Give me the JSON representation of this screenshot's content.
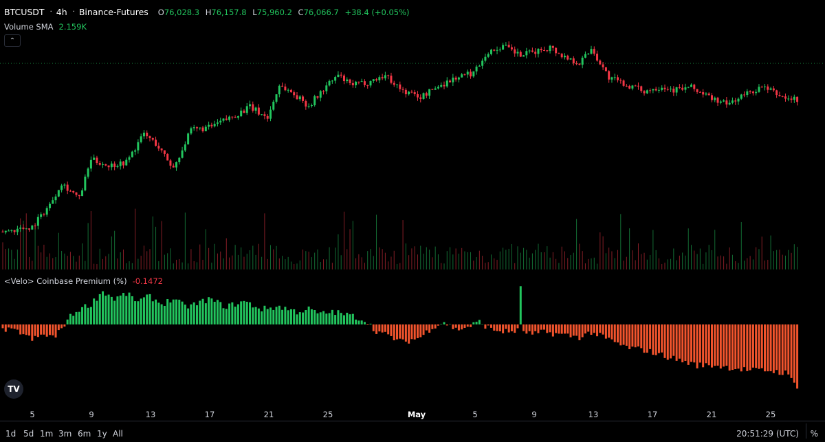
{
  "header": {
    "symbol": "BTCUSDT",
    "timeframe": "4h",
    "exchange": "Binance-Futures",
    "open_key": "O",
    "open": "76,028.3",
    "high_key": "H",
    "high": "76,157.8",
    "low_key": "L",
    "low": "75,960.2",
    "close_key": "C",
    "close": "76,066.7",
    "change": "+38.4 (+0.05%)"
  },
  "volume": {
    "label": "Volume SMA",
    "value": "2.159K"
  },
  "premium": {
    "label": "<Velo> Coinbase Premium (%)",
    "value": "-0.1472"
  },
  "collapse_icon": "chevron-up-icon",
  "logo": "TV",
  "colors": {
    "up": "#22c55e",
    "down": "#f23645",
    "premium_down": "#f2542d",
    "background": "#000000"
  },
  "x_axis": {
    "labels": [
      "5",
      "9",
      "13",
      "17",
      "21",
      "25",
      "May",
      "5",
      "9",
      "13",
      "17",
      "21",
      "25"
    ],
    "emphasized": "May"
  },
  "timeframes": [
    "1d",
    "5d",
    "1m",
    "3m",
    "6m",
    "1y",
    "All"
  ],
  "clock": "20:51:29 (UTC)",
  "percent_toggle": "%",
  "chart_data": {
    "type": "candlestick",
    "interval": "4h",
    "x_ticks": [
      "5",
      "9",
      "13",
      "17",
      "21",
      "25",
      "May",
      "5",
      "9",
      "13",
      "17",
      "21",
      "25"
    ],
    "price_waypoints": [
      [
        0,
        62300
      ],
      [
        10,
        62700
      ],
      [
        16,
        64500
      ],
      [
        20,
        66300
      ],
      [
        26,
        65000
      ],
      [
        30,
        68200
      ],
      [
        36,
        67700
      ],
      [
        42,
        68000
      ],
      [
        48,
        70300
      ],
      [
        52,
        69500
      ],
      [
        58,
        67500
      ],
      [
        64,
        70600
      ],
      [
        70,
        70800
      ],
      [
        78,
        71700
      ],
      [
        84,
        72500
      ],
      [
        90,
        71600
      ],
      [
        94,
        74300
      ],
      [
        98,
        73700
      ],
      [
        104,
        72600
      ],
      [
        110,
        74200
      ],
      [
        114,
        75100
      ],
      [
        118,
        74300
      ],
      [
        124,
        74500
      ],
      [
        130,
        75100
      ],
      [
        136,
        73800
      ],
      [
        142,
        73300
      ],
      [
        148,
        74200
      ],
      [
        154,
        74900
      ],
      [
        160,
        75300
      ],
      [
        164,
        76800
      ],
      [
        170,
        77500
      ],
      [
        176,
        76700
      ],
      [
        182,
        77100
      ],
      [
        186,
        77400
      ],
      [
        190,
        76700
      ],
      [
        196,
        76100
      ],
      [
        200,
        77300
      ],
      [
        206,
        74900
      ],
      [
        212,
        74300
      ],
      [
        218,
        73800
      ],
      [
        224,
        74200
      ],
      [
        228,
        73900
      ],
      [
        234,
        74100
      ],
      [
        240,
        73300
      ],
      [
        246,
        72700
      ],
      [
        252,
        73500
      ],
      [
        258,
        74100
      ],
      [
        262,
        73700
      ],
      [
        266,
        73200
      ],
      [
        270,
        73100
      ]
    ],
    "premium_waypoints": [
      [
        0,
        -0.02
      ],
      [
        6,
        -0.03
      ],
      [
        10,
        -0.06
      ],
      [
        14,
        -0.04
      ],
      [
        18,
        -0.05
      ],
      [
        22,
        0.02
      ],
      [
        26,
        0.06
      ],
      [
        30,
        0.08
      ],
      [
        34,
        0.13
      ],
      [
        38,
        0.1
      ],
      [
        42,
        0.12
      ],
      [
        46,
        0.09
      ],
      [
        50,
        0.11
      ],
      [
        54,
        0.08
      ],
      [
        58,
        0.1
      ],
      [
        62,
        0.07
      ],
      [
        66,
        0.08
      ],
      [
        70,
        0.1
      ],
      [
        76,
        0.07
      ],
      [
        82,
        0.09
      ],
      [
        88,
        0.06
      ],
      [
        94,
        0.07
      ],
      [
        100,
        0.05
      ],
      [
        104,
        0.06
      ],
      [
        108,
        0.04
      ],
      [
        112,
        0.05
      ],
      [
        116,
        0.04
      ],
      [
        120,
        0.03
      ],
      [
        124,
        0.01
      ],
      [
        126,
        -0.02
      ],
      [
        130,
        -0.04
      ],
      [
        136,
        -0.07
      ],
      [
        142,
        -0.05
      ],
      [
        146,
        -0.01
      ],
      [
        150,
        0.01
      ],
      [
        154,
        -0.02
      ],
      [
        158,
        -0.01
      ],
      [
        162,
        0.01
      ],
      [
        166,
        -0.02
      ],
      [
        172,
        -0.03
      ],
      [
        176,
        -0.02
      ],
      [
        180,
        -0.04
      ],
      [
        184,
        -0.03
      ],
      [
        190,
        -0.04
      ],
      [
        196,
        -0.05
      ],
      [
        200,
        -0.03
      ],
      [
        206,
        -0.06
      ],
      [
        212,
        -0.09
      ],
      [
        218,
        -0.1
      ],
      [
        224,
        -0.12
      ],
      [
        230,
        -0.14
      ],
      [
        236,
        -0.16
      ],
      [
        242,
        -0.16
      ],
      [
        248,
        -0.17
      ],
      [
        254,
        -0.18
      ],
      [
        260,
        -0.18
      ],
      [
        266,
        -0.19
      ],
      [
        270,
        -0.24
      ]
    ],
    "price_range": [
      61000,
      79000
    ],
    "premium_range": [
      -0.28,
      0.16
    ],
    "current_price": 76066.7
  }
}
